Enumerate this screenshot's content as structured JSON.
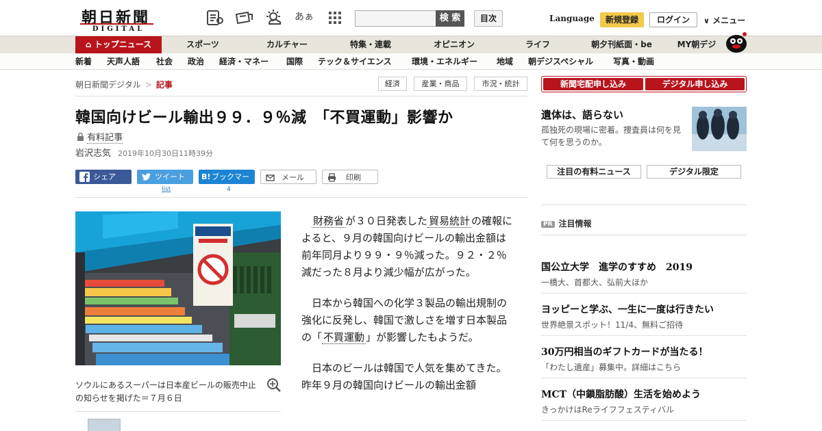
{
  "header": {
    "logo_kanji": "朝日新聞",
    "logo_sub": "DIGITAL",
    "icons": [
      "news-list-icon",
      "paper-icon",
      "weather-icon",
      "font-size-icon",
      "grid-menu-icon"
    ],
    "font_icon_text": "あぁ",
    "search_placeholder": "",
    "search_label": "検 索",
    "index_label": "目次",
    "language_label": "Language",
    "register_label": "新規登録",
    "login_label": "ログイン",
    "menu_label": "メニュー"
  },
  "nav_main": [
    "トップニュース",
    "スポーツ",
    "カルチャー",
    "特集・連載",
    "オピニオン",
    "ライフ",
    "朝夕刊紙面・be",
    "MY朝デジ"
  ],
  "nav_sub": [
    "新着",
    "天声人語",
    "社会",
    "政治",
    "経済・マネー",
    "国際",
    "テック＆サイエンス",
    "環境・エネルギー",
    "地域",
    "朝デジスペシャル",
    "写真・動画"
  ],
  "breadcrumb": {
    "home": "朝日新聞デジタル",
    "separator": ">",
    "current": "記事"
  },
  "tags": [
    "経済",
    "産業・商品",
    "市況・統計"
  ],
  "article": {
    "title": "韓国向けビール輸出９９．９％減　「不買運動」影響か",
    "paid_label": "有料記事",
    "author": "岩沢志気",
    "date": "2019年10月30日11時39分",
    "share": {
      "facebook": "シェア",
      "twitter": "ツイート",
      "twitter_count": "list",
      "hatena": "ブックマーク",
      "hatena_count": "4",
      "mail": "メール",
      "print": "印刷"
    },
    "photo_caption": "ソウルにあるスーパーは日本産ビールの販売中止の知らせを掲げた＝７月６日",
    "paragraphs": [
      {
        "pre": "",
        "link": "財務省",
        "mid": "が３０日発表した",
        "link2": "貿易統計",
        "post": "の確報によると、９月の韓国向けビールの輸出金額は前年同月より９９・９％減った。９２・２％減だった８月より減少幅が広がった。"
      },
      {
        "pre": "日本から韓国への化学３製品の輸出規制の強化に反発し、韓国で激しさを増す日本製品の「",
        "link": "不買運動",
        "mid": "」が影響したもようだ。",
        "link2": "",
        "post": ""
      },
      {
        "pre": "日本のビールは韓国で人気を集めてきた。昨年９月の韓国向けビールの輸出金額",
        "link": "",
        "mid": "",
        "link2": "",
        "post": ""
      }
    ]
  },
  "right": {
    "subscribe_paper": "新聞宅配申し込み",
    "subscribe_digital": "デジタル申し込み",
    "feature_title": "遺体は、語らない",
    "feature_desc": "孤独死の現場に密着。捜査員は何を見て何を思うのか。",
    "tab_paid": "注目の有料ニュース",
    "tab_digital": "デジタル限定",
    "pr_badge": "PR",
    "pr_label": "注目情報",
    "pr_items": [
      {
        "title": "国公立大学　進学のすすめ　2019",
        "desc": "一橋大、首都大、弘前大ほか"
      },
      {
        "title": "ヨッピーと学ぶ、一生に一度は行きたい",
        "desc": "世界絶景スポット！11/4、無料ご招待"
      },
      {
        "title": "30万円相当のギフトカードが当たる！",
        "desc": "「わたし遺産」募集中。詳細はこちら"
      },
      {
        "title": "MCT（中鎖脂肪酸）生活を始めよう",
        "desc": "きっかけはReライフフェスティバル"
      }
    ]
  },
  "colors": {
    "brand_red": "#b8141c",
    "register_yellow": "#f2c94a",
    "facebook": "#3b5998",
    "twitter": "#4a9fe0",
    "hatena": "#1d84d4"
  }
}
